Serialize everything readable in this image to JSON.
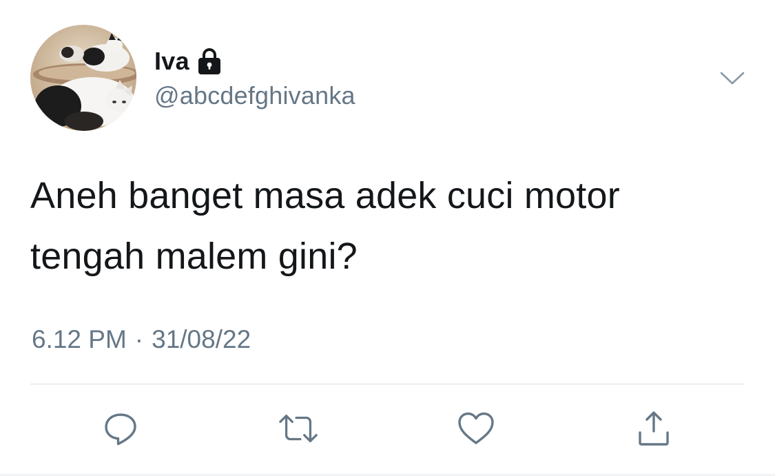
{
  "author": {
    "display_name": "Iva",
    "username": "@abcdefghivanka",
    "protected_icon": "lock-icon",
    "avatar": "avatar-cats-photo"
  },
  "tweet": {
    "text": "Aneh banget masa adek cuci motor\ntengah malem gini?",
    "time": "6.12 PM",
    "separator": "·",
    "date": "31/08/22"
  },
  "actions": {
    "reply_icon": "reply-icon",
    "retweet_icon": "retweet-icon",
    "like_icon": "heart-icon",
    "share_icon": "share-icon",
    "more_icon": "chevron-down-icon"
  },
  "colors": {
    "text_primary": "#14171a",
    "text_secondary": "#657786",
    "icon": "#657786",
    "divider": "#d9dde1"
  }
}
